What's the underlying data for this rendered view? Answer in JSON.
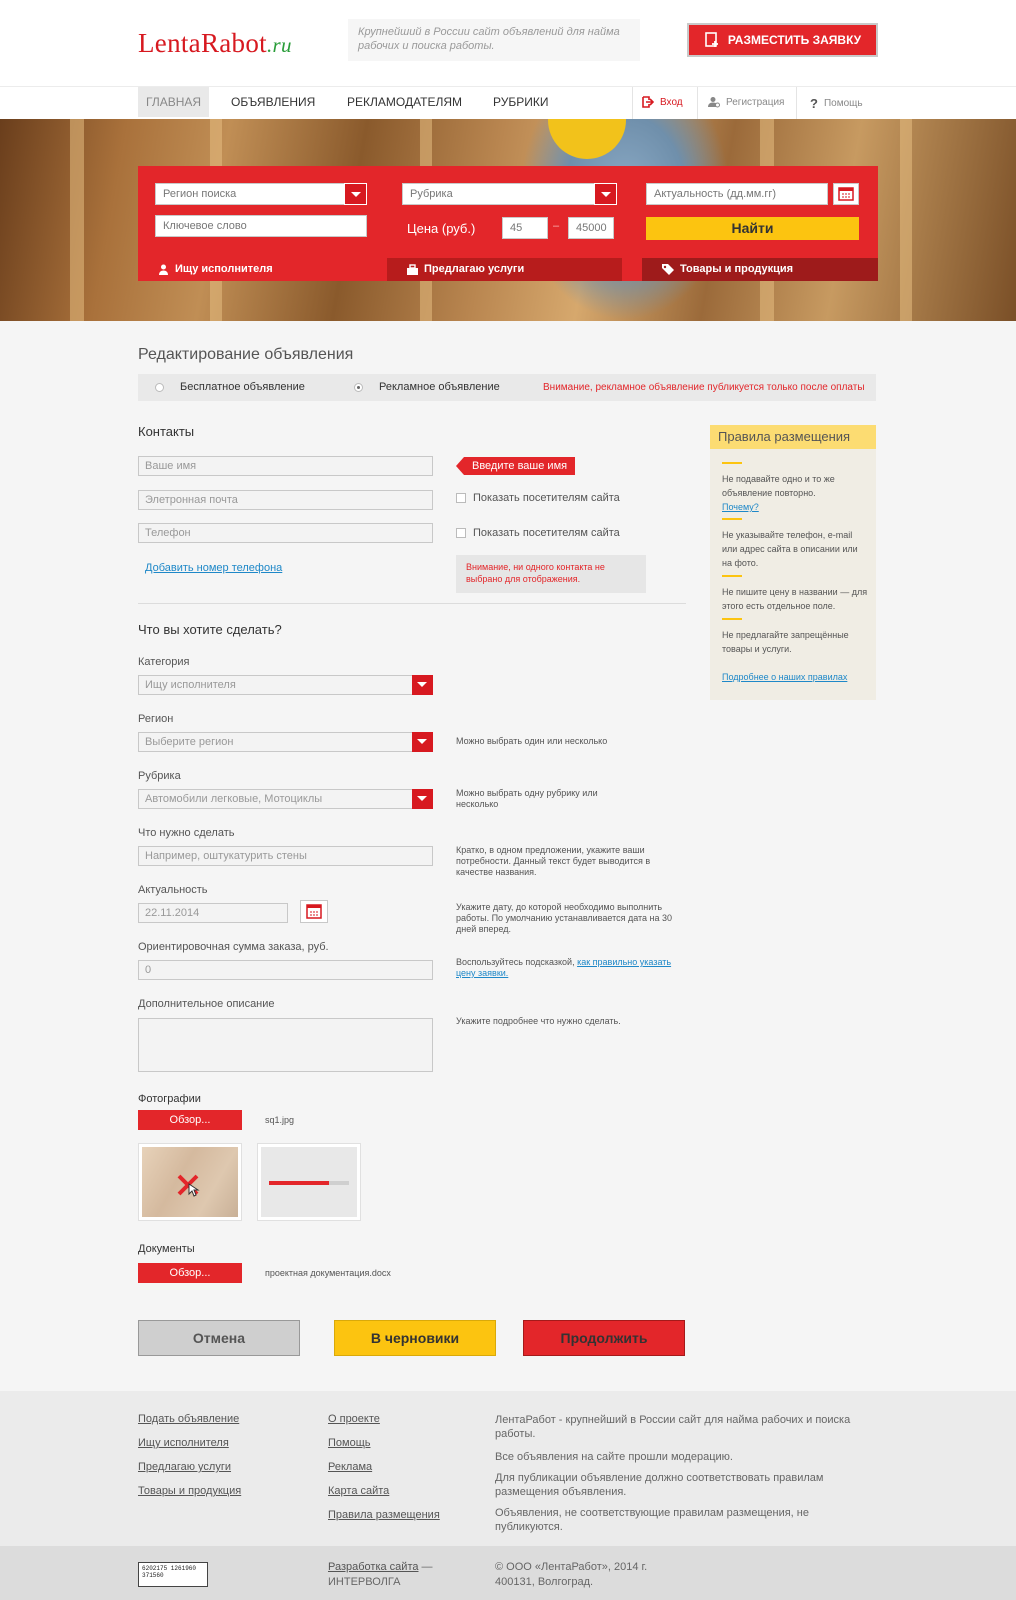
{
  "header": {
    "logo_main": "LentaRabot",
    "logo_ru": ".ru",
    "tagline": "Крупнейший в России сайт объявлений для найма рабочих и поиска работы.",
    "post_button": "РАЗМЕСТИТЬ ЗАЯВКУ"
  },
  "nav": {
    "items": [
      "ГЛАВНАЯ",
      "ОБЪЯВЛЕНИЯ",
      "РЕКЛАМОДАТЕЛЯМ",
      "РУБРИКИ"
    ],
    "login": "Вход",
    "register": "Регистрация",
    "help": "Помощь"
  },
  "search": {
    "region_placeholder": "Регион поиска",
    "keyword_placeholder": "Ключевое слово",
    "rubric_placeholder": "Рубрика",
    "price_label": "Цена (руб.)",
    "price_from": "45",
    "price_to": "45000",
    "price_sep": "–",
    "date_placeholder": "Актуальность (дд.мм.гг)",
    "find_button": "Найти",
    "tabs": [
      "Ищу исполнителя",
      "Предлагаю услуги",
      "Товары и продукция"
    ]
  },
  "form": {
    "title": "Редактирование объявления",
    "type_free": "Бесплатное объявление",
    "type_paid": "Рекламное объявление",
    "type_notice": "Внимание, рекламное объявление публикуется только после оплаты",
    "contacts_title": "Контакты",
    "name_placeholder": "Ваше имя",
    "name_error": "Введите ваше имя",
    "email_placeholder": "Элетронная почта",
    "phone_placeholder": "Телефон",
    "show_visitors": "Показать посетителям сайта",
    "add_phone": "Добавить номер телефона",
    "contact_warning": "Внимание, ни одного контакта не выбрано для отображения.",
    "what_title": "Что вы хотите сделать?",
    "category_label": "Категория",
    "category_value": "Ищу исполнителя",
    "region_label": "Регион",
    "region_placeholder": "Выберите регион",
    "region_hint": "Можно выбрать один или несколько",
    "rubric_label": "Рубрика",
    "rubric_value": "Автомобили легковые, Мотоциклы",
    "rubric_hint": "Можно выбрать одну рубрику или несколько",
    "task_label": "Что нужно сделать",
    "task_placeholder": "Например, оштукатурить стены",
    "task_hint": "Кратко, в одном предложении, укажите ваши потребности. Данный текст будет выводится в качестве названия.",
    "date_label": "Актуальность",
    "date_value": "22.11.2014",
    "date_hint": "Укажите дату, до которой необходимо выполнить работы. По умолчанию устанавливается дата на 30 дней вперед.",
    "sum_label": "Ориентировочная сумма заказа, руб.",
    "sum_value": "0",
    "sum_hint": "Воспользуйтесь подсказкой,",
    "sum_hint_link": "как правильно указать цену заявки.",
    "desc_label": "Дополнительное описание",
    "desc_hint": "Укажите подробнее что нужно сделать.",
    "photos_label": "Фотографии",
    "browse": "Обзор...",
    "photo_file": "sq1.jpg",
    "upload_progress": 0.75,
    "docs_label": "Документы",
    "doc_file": "проектная документация.docx",
    "cancel": "Отмена",
    "draft": "В черновики",
    "continue": "Продолжить"
  },
  "rules": {
    "title": "Правила размещения",
    "items": [
      "Не подавайте одно и то же объявление повторно.",
      "Не указывайте телефон, e-mail или адрес сайта в описании или на фото.",
      "Не пишите цену в названии — для этого есть отдельное поле.",
      "Не предлагайте запрещённые товары и услуги."
    ],
    "why": "Почему?",
    "more": "Подробнее о наших правилах"
  },
  "footer": {
    "col1": [
      "Подать объявление",
      "Ищу исполнителя",
      "Предлагаю услуги",
      "Товары и продукция"
    ],
    "col2": [
      "О проекте",
      "Помощь",
      "Реклама",
      "Карта сайта",
      "Правила размещения"
    ],
    "about": [
      "ЛентаРабот - крупнейший в России сайт для найма рабочих и поиска работы.",
      "Все объявления на сайте прошли модерацию.",
      "Для публикации объявление должно соответствовать правилам размещения объявления.",
      "Объявления, не соответствующие правилам размещения, не публикуются."
    ],
    "dev_link": "Разработка сайта",
    "dev_name": "— ИНТЕРВОЛГА",
    "copyright": "© ООО «ЛентаРабот», 2014 г.",
    "address": "400131, Волгоград.",
    "counter": "6202175 1261960 371560"
  },
  "colors": {
    "brand_red": "#e3262a",
    "yellow": "#fcc410",
    "link": "#1e88c8"
  }
}
